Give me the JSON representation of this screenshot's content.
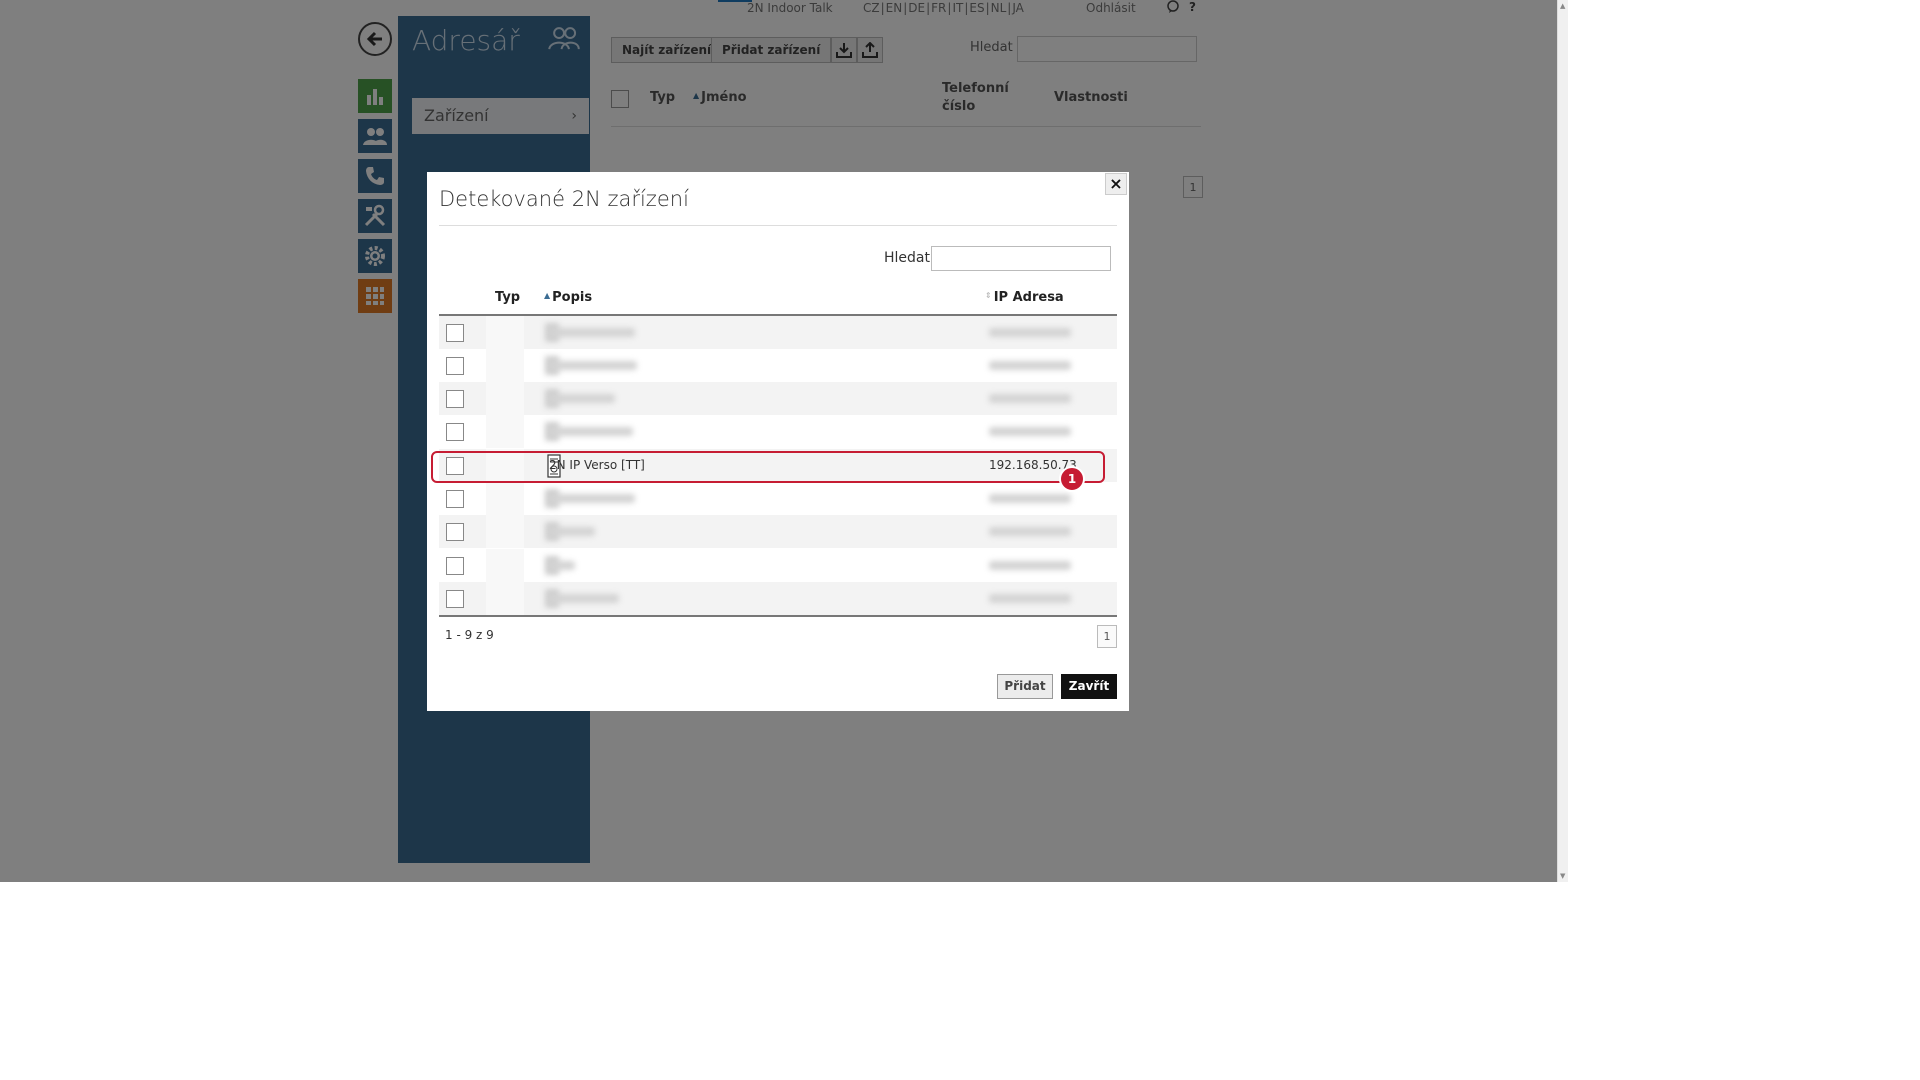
{
  "topbar": {
    "device_name": "2N Indoor Talk",
    "languages": [
      "CZ",
      "EN",
      "DE",
      "FR",
      "IT",
      "ES",
      "NL",
      "JA"
    ],
    "logout": "Odhlásit",
    "help": "?"
  },
  "sidebar": {
    "title": "Adresář",
    "menu_item": "Zařízení"
  },
  "main": {
    "find_button": "Najít zařízení",
    "add_button": "Přidat zařízení",
    "search_label": "Hledat",
    "col_typ": "Typ",
    "col_name": "Jméno",
    "col_phone": "Telefonní číslo",
    "col_props": "Vlastnosti",
    "page": "1"
  },
  "modal": {
    "title": "Detekované 2N zařízení",
    "search_label": "Hledat",
    "search_value": "",
    "columns": {
      "typ": "Typ",
      "popis": "Popis",
      "ip": "IP Adresa"
    },
    "highlighted_row": {
      "description": "2N IP Verso [TT]",
      "ip": "192.168.50.73"
    },
    "marker": "1",
    "count_text": "1 - 9 z 9",
    "page": "1",
    "add_button": "Přidat",
    "close_button": "Zavřít"
  },
  "colors": {
    "sidebar_bg": "#3b6c93",
    "highlight": "#c61c33",
    "rail_green": "#4ea34b",
    "rail_blue": "#3b6c93",
    "rail_orange": "#e07a27"
  }
}
